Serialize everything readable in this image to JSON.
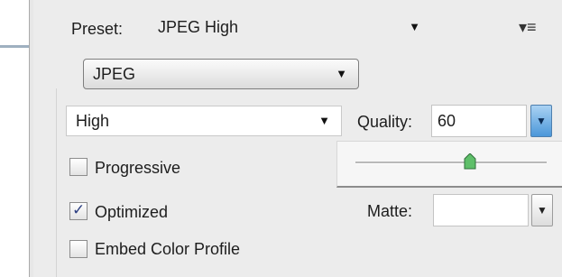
{
  "preset": {
    "label": "Preset:",
    "value": "JPEG High",
    "arrow": "▼"
  },
  "menu": {
    "icon": "panel-menu-icon",
    "glyph": "▾≡"
  },
  "format": {
    "value": "JPEG",
    "arrow": "▼"
  },
  "compression": {
    "value": "High",
    "arrow": "▼"
  },
  "quality": {
    "label": "Quality:",
    "value": "60",
    "arrow": "▼",
    "slider_fraction": 0.6,
    "accent": "#4b97d9"
  },
  "options": {
    "progressive": {
      "label": "Progressive",
      "checked": false
    },
    "optimized": {
      "label": "Optimized",
      "checked": true,
      "check_glyph": "✓"
    },
    "embed_color_profile": {
      "label": "Embed Color Profile",
      "checked": false
    }
  },
  "matte": {
    "label": "Matte:",
    "value": "",
    "arrow": "▼"
  }
}
